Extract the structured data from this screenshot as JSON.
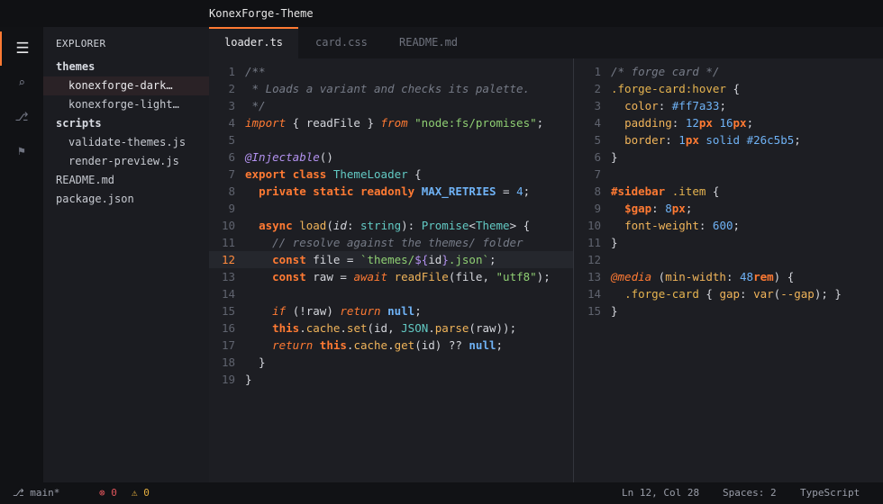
{
  "window": {
    "title": "KonexForge-Theme"
  },
  "activity": {
    "items": [
      {
        "icon": "files-icon",
        "glyph": "☰"
      },
      {
        "icon": "search-icon",
        "glyph": "⌕"
      },
      {
        "icon": "source-control-icon",
        "glyph": "⎇"
      },
      {
        "icon": "debug-icon",
        "glyph": "⚑"
      }
    ]
  },
  "sidebar": {
    "heading": "EXPLORER",
    "tree": [
      {
        "label": "themes",
        "kind": "folder"
      },
      {
        "label": "konexforge-dark…",
        "kind": "child",
        "selected": true
      },
      {
        "label": "konexforge-light…",
        "kind": "child"
      },
      {
        "label": "scripts",
        "kind": "folder"
      },
      {
        "label": "validate-themes.js",
        "kind": "child"
      },
      {
        "label": "render-preview.js",
        "kind": "child"
      },
      {
        "label": "README.md",
        "kind": "file"
      },
      {
        "label": "package.json",
        "kind": "file"
      }
    ]
  },
  "tabs": [
    {
      "label": "loader.ts",
      "active": true
    },
    {
      "label": "card.css",
      "active": false
    },
    {
      "label": "README.md",
      "active": false
    }
  ],
  "editor_left": {
    "current_line": 12,
    "lines": [
      [
        [
          "/**",
          "comment"
        ]
      ],
      [
        [
          " * Loads a variant and checks its palette.",
          "comment"
        ]
      ],
      [
        [
          " */",
          "comment"
        ]
      ],
      [
        [
          "import",
          "kwi"
        ],
        [
          " { readFile } ",
          ""
        ],
        [
          "from",
          "kwi"
        ],
        [
          " ",
          ""
        ],
        [
          "\"node:fs/promises\"",
          "str"
        ],
        [
          ";",
          ""
        ]
      ],
      [],
      [
        [
          "@Injectable",
          "dec"
        ],
        [
          "()",
          ""
        ]
      ],
      [
        [
          "export",
          "kw"
        ],
        [
          " ",
          ""
        ],
        [
          "class",
          "kw"
        ],
        [
          " ",
          ""
        ],
        [
          "ThemeLoader",
          "type"
        ],
        [
          " {",
          ""
        ]
      ],
      [
        [
          "  ",
          ""
        ],
        [
          "private",
          "kw"
        ],
        [
          " ",
          ""
        ],
        [
          "static",
          "kw"
        ],
        [
          " ",
          ""
        ],
        [
          "readonly",
          "kw"
        ],
        [
          " ",
          ""
        ],
        [
          "MAX_RETRIES",
          "const"
        ],
        [
          " = ",
          ""
        ],
        [
          "4",
          "num"
        ],
        [
          ";",
          ""
        ]
      ],
      [],
      [
        [
          "  ",
          ""
        ],
        [
          "async",
          "kw"
        ],
        [
          " ",
          ""
        ],
        [
          "load",
          "fn"
        ],
        [
          "(",
          ""
        ],
        [
          "id",
          "param"
        ],
        [
          ": ",
          ""
        ],
        [
          "string",
          "type"
        ],
        [
          "): ",
          ""
        ],
        [
          "Promise",
          "type"
        ],
        [
          "<",
          ""
        ],
        [
          "Theme",
          "type"
        ],
        [
          "> {",
          ""
        ]
      ],
      [
        [
          "    // resolve against the themes/ folder",
          "comment"
        ]
      ],
      [
        [
          "    ",
          ""
        ],
        [
          "const",
          "kw"
        ],
        [
          " file = ",
          ""
        ],
        [
          "`themes/",
          "str"
        ],
        [
          "${",
          "interp"
        ],
        [
          "id",
          ""
        ],
        [
          "}",
          "interp"
        ],
        [
          ".json`",
          "str"
        ],
        [
          ";",
          ""
        ]
      ],
      [
        [
          "    ",
          ""
        ],
        [
          "const",
          "kw"
        ],
        [
          " raw = ",
          ""
        ],
        [
          "await",
          "kwi"
        ],
        [
          " ",
          ""
        ],
        [
          "readFile",
          "fn"
        ],
        [
          "(file, ",
          ""
        ],
        [
          "\"utf8\"",
          "str"
        ],
        [
          ");",
          ""
        ]
      ],
      [],
      [
        [
          "    ",
          ""
        ],
        [
          "if",
          "kwi"
        ],
        [
          " (!raw) ",
          ""
        ],
        [
          "return",
          "kwi"
        ],
        [
          " ",
          ""
        ],
        [
          "null",
          "const"
        ],
        [
          ";",
          ""
        ]
      ],
      [
        [
          "    ",
          ""
        ],
        [
          "this",
          "kw"
        ],
        [
          ".",
          ""
        ],
        [
          "cache",
          "prop"
        ],
        [
          ".",
          ""
        ],
        [
          "set",
          "fn"
        ],
        [
          "(id, ",
          ""
        ],
        [
          "JSON",
          "type"
        ],
        [
          ".",
          ""
        ],
        [
          "parse",
          "fn"
        ],
        [
          "(raw));",
          ""
        ]
      ],
      [
        [
          "    ",
          ""
        ],
        [
          "return",
          "kwi"
        ],
        [
          " ",
          ""
        ],
        [
          "this",
          "kw"
        ],
        [
          ".",
          ""
        ],
        [
          "cache",
          "prop"
        ],
        [
          ".",
          ""
        ],
        [
          "get",
          "fn"
        ],
        [
          "(id) ?? ",
          ""
        ],
        [
          "null",
          "const"
        ],
        [
          ";",
          ""
        ]
      ],
      [
        [
          "  }",
          ""
        ]
      ],
      [
        [
          "}",
          ""
        ]
      ]
    ]
  },
  "editor_right": {
    "lines": [
      [
        [
          "/* forge card */",
          "comment"
        ]
      ],
      [
        [
          ".forge-card:hover",
          "var"
        ],
        [
          " {",
          ""
        ]
      ],
      [
        [
          "  ",
          ""
        ],
        [
          "color",
          "prop"
        ],
        [
          ": ",
          ""
        ],
        [
          "#ff7a33",
          "num"
        ],
        [
          ";",
          ""
        ]
      ],
      [
        [
          "  ",
          ""
        ],
        [
          "padding",
          "prop"
        ],
        [
          ": ",
          ""
        ],
        [
          "12",
          "num"
        ],
        [
          "px",
          "kw"
        ],
        [
          " ",
          ""
        ],
        [
          "16",
          "num"
        ],
        [
          "px",
          "kw"
        ],
        [
          ";",
          ""
        ]
      ],
      [
        [
          "  ",
          ""
        ],
        [
          "border",
          "prop"
        ],
        [
          ": ",
          ""
        ],
        [
          "1",
          "num"
        ],
        [
          "px",
          "kw"
        ],
        [
          " ",
          ""
        ],
        [
          "solid",
          "num"
        ],
        [
          " ",
          ""
        ],
        [
          "#26c5b5",
          "num"
        ],
        [
          ";",
          ""
        ]
      ],
      [
        [
          "}",
          ""
        ]
      ],
      [],
      [
        [
          "#sidebar",
          "kw"
        ],
        [
          " ",
          ""
        ],
        [
          ".item",
          "var"
        ],
        [
          " {",
          ""
        ]
      ],
      [
        [
          "  ",
          ""
        ],
        [
          "$gap",
          "kw"
        ],
        [
          ": ",
          ""
        ],
        [
          "8",
          "num"
        ],
        [
          "px",
          "kw"
        ],
        [
          ";",
          ""
        ]
      ],
      [
        [
          "  ",
          ""
        ],
        [
          "font-weight",
          "prop"
        ],
        [
          ": ",
          ""
        ],
        [
          "600",
          "num"
        ],
        [
          ";",
          ""
        ]
      ],
      [
        [
          "}",
          ""
        ]
      ],
      [],
      [
        [
          "@media",
          "kwi"
        ],
        [
          " (",
          ""
        ],
        [
          "min-width",
          "prop"
        ],
        [
          ": ",
          ""
        ],
        [
          "48",
          "num"
        ],
        [
          "rem",
          "kw"
        ],
        [
          ") {",
          ""
        ]
      ],
      [
        [
          "  ",
          ""
        ],
        [
          ".forge-card",
          "var"
        ],
        [
          " { ",
          ""
        ],
        [
          "gap",
          "prop"
        ],
        [
          ": ",
          ""
        ],
        [
          "var",
          "fn"
        ],
        [
          "(",
          ""
        ],
        [
          "--gap",
          "prop"
        ],
        [
          "); }",
          ""
        ]
      ],
      [
        [
          "}",
          ""
        ]
      ]
    ]
  },
  "status": {
    "branch": "⎇ main*",
    "errors": "⊗ 0",
    "warnings": "⚠ 0",
    "position": "Ln 12, Col 28",
    "spaces": "Spaces: 2",
    "language": "TypeScript"
  }
}
